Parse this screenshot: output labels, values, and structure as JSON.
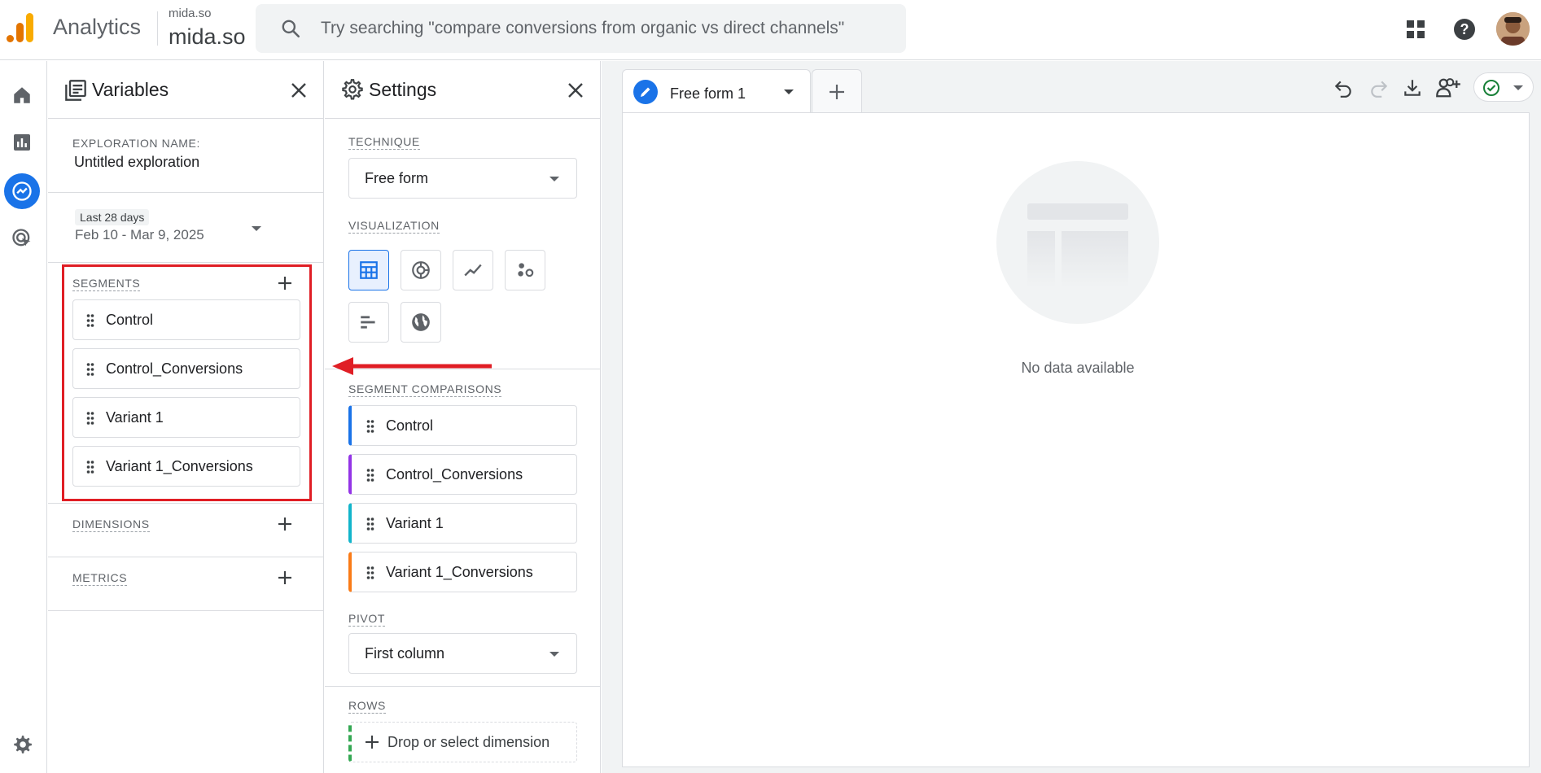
{
  "header": {
    "app_name": "Analytics",
    "property_account": "mida.so",
    "property_name": "mida.so",
    "search_placeholder": "Try searching \"compare conversions from organic vs direct channels\""
  },
  "rail": {
    "items": [
      {
        "icon": "home-icon"
      },
      {
        "icon": "reports-icon"
      },
      {
        "icon": "explore-icon",
        "active": true
      },
      {
        "icon": "advertising-icon"
      }
    ],
    "settings_icon": "gear-icon"
  },
  "variables": {
    "title": "Variables",
    "exploration_name_label": "EXPLORATION NAME:",
    "exploration_name": "Untitled exploration",
    "date_preset": "Last 28 days",
    "date_range": "Feb 10 - Mar 9, 2025",
    "segments_label": "SEGMENTS",
    "segments": [
      "Control",
      "Control_Conversions",
      "Variant 1",
      "Variant 1_Conversions"
    ],
    "dimensions_label": "DIMENSIONS",
    "metrics_label": "METRICS"
  },
  "settings": {
    "title": "Settings",
    "technique_label": "TECHNIQUE",
    "technique_value": "Free form",
    "visualization_label": "VISUALIZATION",
    "visualizations": [
      "table-icon",
      "donut-chart-icon",
      "line-chart-icon",
      "scatter-chart-icon",
      "bar-chart-icon",
      "geo-map-icon"
    ],
    "segment_comparisons_label": "SEGMENT COMPARISONS",
    "segment_comparisons": [
      {
        "label": "Control",
        "color": "#1a73e8"
      },
      {
        "label": "Control_Conversions",
        "color": "#9334e6"
      },
      {
        "label": "Variant 1",
        "color": "#12b5cb"
      },
      {
        "label": "Variant 1_Conversions",
        "color": "#fa7b17"
      }
    ],
    "pivot_label": "PIVOT",
    "pivot_value": "First column",
    "rows_label": "ROWS",
    "rows_placeholder": "Drop or select dimension"
  },
  "canvas": {
    "tab_label": "Free form 1",
    "empty_message": "No data available"
  },
  "colors": {
    "accent": "#1a73e8",
    "highlight": "#e01e25"
  }
}
